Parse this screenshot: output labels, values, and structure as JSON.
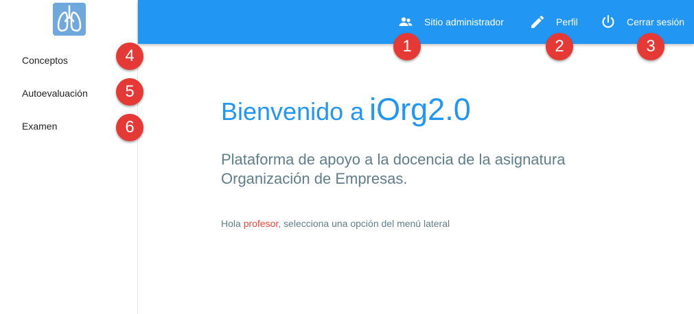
{
  "colors": {
    "primary": "#2196f3",
    "marker": "#e53935",
    "username": "#f44336",
    "muted_text": "#5f7d8b"
  },
  "sidebar": {
    "logo_icon": "lungs-logo-icon",
    "items": [
      {
        "label": "Conceptos"
      },
      {
        "label": "Autoevaluación"
      },
      {
        "label": "Examen"
      }
    ]
  },
  "topbar": {
    "admin": {
      "label": "Sitio administrador",
      "icon": "people-icon"
    },
    "profile": {
      "label": "Perfil",
      "icon": "pencil-icon"
    },
    "logout": {
      "label": "Cerrar sesión",
      "icon": "power-icon"
    }
  },
  "markers": [
    "1",
    "2",
    "3",
    "4",
    "5",
    "6"
  ],
  "main": {
    "welcome_prefix": "Bienvenido a",
    "app_name": "iOrg2.0",
    "subtitle_line1": "Plataforma de apoyo a la docencia de la asignatura",
    "subtitle_line2": "Organización de Empresas.",
    "greeting_prefix": "Hola ",
    "username": "profesor",
    "greeting_suffix": ", selecciona una opción del menú lateral"
  }
}
